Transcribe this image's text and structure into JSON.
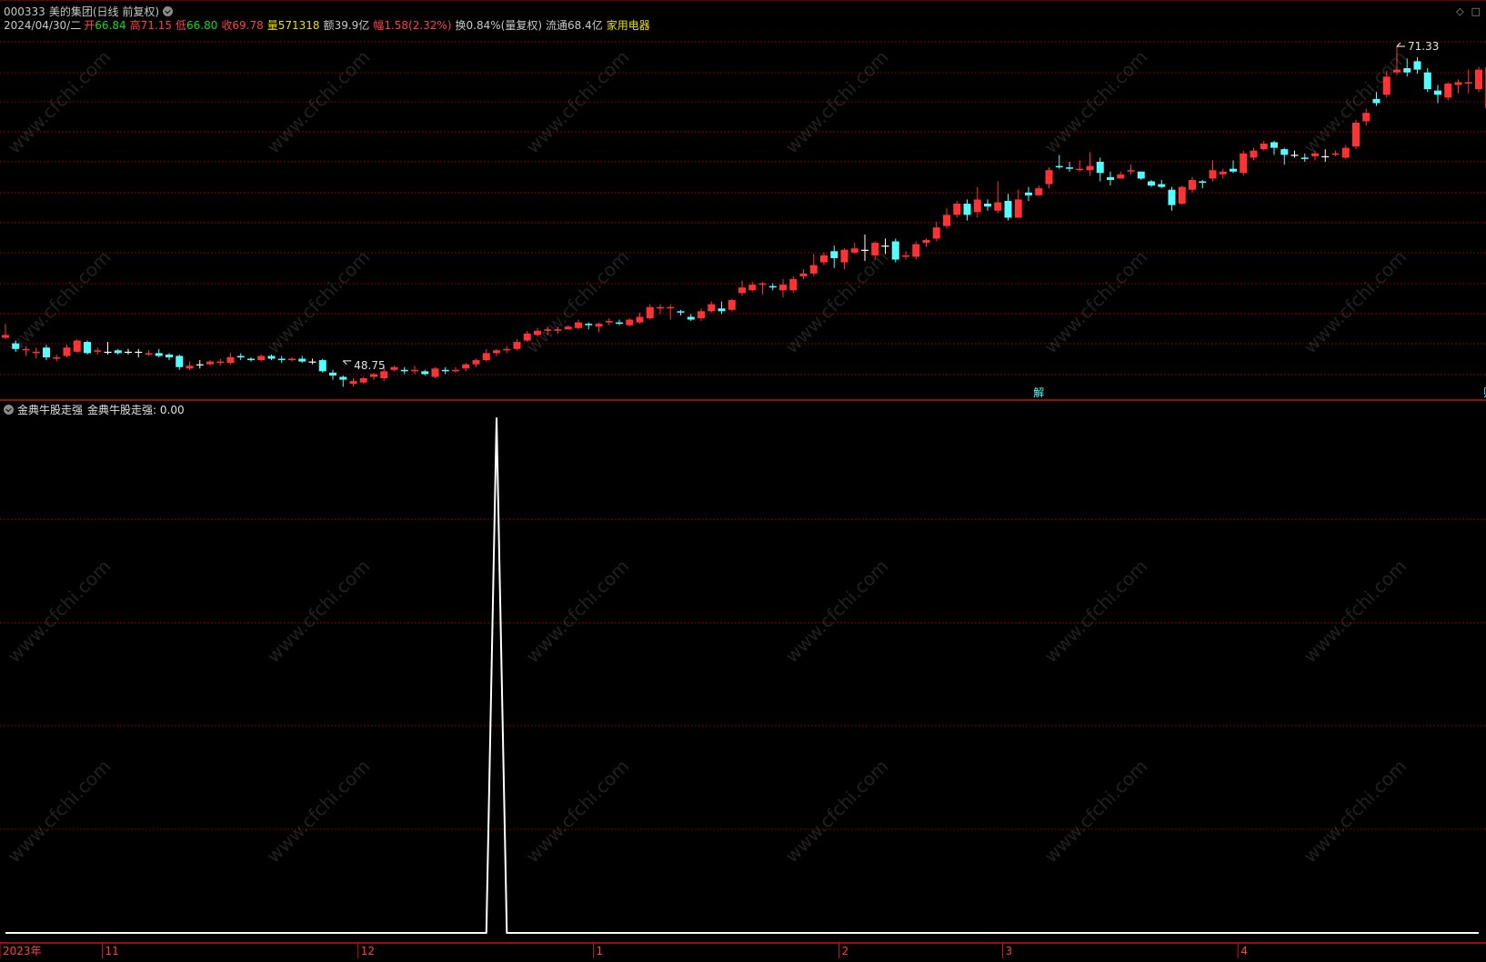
{
  "header": {
    "code": "000333",
    "name": "美的集团",
    "period": "(日线 前复权)",
    "date": "2024/04/30/二",
    "open_label": "开",
    "open": "66.84",
    "high_label": "高",
    "high": "71.15",
    "low_label": "低",
    "low": "66.80",
    "close_label": "收",
    "close": "69.78",
    "vol_label": "量",
    "vol": "571318",
    "amt_label": "额",
    "amt": "39.9亿",
    "chg_label": "幅",
    "chg": "1.58(2.32%)",
    "turn_label": "换",
    "turn": "0.84%(量复权)",
    "float_label": "流通",
    "float": "68.4亿",
    "industry": "家用电器"
  },
  "window_controls": {
    "pin": "◇",
    "close": "□"
  },
  "indicator": {
    "name": "金典牛股走强",
    "line_label": "金典牛股走强:",
    "value": "0.00"
  },
  "watermark": "www.cfchi.com",
  "colors": {
    "up": "#ff3333",
    "down": "#54ffff",
    "doji": "#ffffff",
    "grid": "#8b0000",
    "indicator_line": "#ffffff",
    "axis_text": "#ff4040"
  },
  "chart_data": [
    {
      "type": "candlestick",
      "high_marker": {
        "label": "71.33",
        "value": 71.33
      },
      "low_marker": {
        "label": "48.75",
        "value": 48.75
      },
      "event_markers": [
        {
          "label": "解"
        },
        {
          "label": "财"
        }
      ],
      "candles": [
        [
          50.4,
          50.6,
          51.4,
          50.3
        ],
        [
          50.0,
          49.6,
          50.2,
          49.4
        ],
        [
          49.5,
          49.6,
          49.8,
          49.1
        ],
        [
          49.3,
          49.4,
          49.7,
          48.9
        ],
        [
          49.7,
          49.0,
          49.9,
          48.8
        ],
        [
          48.9,
          49.0,
          49.2,
          48.7
        ],
        [
          49.1,
          49.7,
          49.9,
          49.0
        ],
        [
          49.4,
          50.2,
          50.3,
          49.3
        ],
        [
          50.1,
          49.3,
          50.2,
          49.2
        ],
        [
          49.4,
          49.5,
          49.7,
          49.2
        ],
        [
          49.4,
          49.4,
          50.1,
          49.2
        ],
        [
          49.5,
          49.3,
          49.6,
          49.2
        ],
        [
          49.4,
          49.4,
          49.6,
          49.2
        ],
        [
          49.4,
          49.4,
          49.6,
          49.0
        ],
        [
          49.2,
          49.3,
          49.5,
          49.1
        ],
        [
          49.3,
          49.1,
          49.6,
          49.0
        ],
        [
          49.2,
          49.0,
          49.3,
          48.8
        ],
        [
          49.1,
          48.3,
          49.2,
          48.1
        ],
        [
          48.2,
          48.4,
          48.7,
          48.1
        ],
        [
          48.5,
          48.5,
          48.8,
          48.2
        ],
        [
          48.5,
          48.7,
          48.8,
          48.4
        ],
        [
          48.6,
          48.7,
          48.9,
          48.4
        ],
        [
          48.6,
          49.0,
          49.3,
          48.5
        ],
        [
          49.1,
          49.0,
          49.3,
          48.8
        ],
        [
          48.9,
          48.8,
          49.0,
          48.7
        ],
        [
          48.8,
          49.1,
          49.2,
          48.7
        ],
        [
          49.1,
          48.9,
          49.2,
          48.8
        ],
        [
          48.9,
          48.8,
          49.1,
          48.6
        ],
        [
          48.8,
          48.9,
          49.0,
          48.7
        ],
        [
          48.9,
          48.7,
          49.1,
          48.6
        ],
        [
          48.7,
          48.7,
          48.9,
          48.5
        ],
        [
          48.8,
          48.0,
          48.9,
          47.9
        ],
        [
          47.9,
          47.7,
          48.1,
          47.4
        ],
        [
          47.6,
          47.4,
          47.7,
          46.9
        ],
        [
          47.1,
          47.3,
          47.5,
          46.9
        ],
        [
          47.2,
          47.5,
          47.6,
          47.1
        ],
        [
          47.6,
          47.8,
          47.9,
          47.4
        ],
        [
          47.5,
          48.0,
          48.3,
          47.3
        ],
        [
          48.1,
          48.3,
          48.4,
          48.0
        ],
        [
          48.1,
          48.0,
          48.3,
          47.8
        ],
        [
          48.0,
          48.1,
          48.4,
          47.8
        ],
        [
          48.0,
          47.8,
          48.1,
          47.7
        ],
        [
          47.6,
          48.2,
          48.3,
          47.5
        ],
        [
          48.1,
          48.0,
          48.3,
          47.8
        ],
        [
          48.0,
          48.1,
          48.3,
          47.9
        ],
        [
          48.2,
          48.5,
          48.6,
          48.0
        ],
        [
          48.5,
          48.8,
          48.9,
          48.3
        ],
        [
          48.8,
          49.3,
          49.6,
          48.7
        ],
        [
          49.3,
          49.5,
          49.6,
          49.1
        ],
        [
          49.5,
          49.6,
          49.8,
          49.3
        ],
        [
          49.6,
          50.1,
          50.3,
          49.5
        ],
        [
          50.2,
          50.7,
          50.9,
          50.1
        ],
        [
          50.6,
          50.9,
          51.1,
          50.5
        ],
        [
          50.9,
          51.0,
          51.2,
          50.6
        ],
        [
          50.9,
          51.0,
          51.2,
          50.7
        ],
        [
          51.0,
          51.2,
          51.3,
          51.0
        ],
        [
          51.1,
          51.5,
          51.7,
          51.0
        ],
        [
          51.4,
          51.3,
          51.5,
          51.0
        ],
        [
          51.2,
          51.4,
          51.5,
          50.8
        ],
        [
          51.5,
          51.6,
          51.8,
          51.3
        ],
        [
          51.5,
          51.4,
          51.7,
          51.3
        ],
        [
          51.3,
          51.7,
          51.8,
          51.2
        ],
        [
          51.5,
          51.9,
          52.2,
          51.4
        ],
        [
          51.8,
          52.6,
          52.8,
          51.7
        ],
        [
          52.5,
          52.6,
          52.8,
          52.1
        ],
        [
          52.5,
          52.6,
          52.8,
          51.7
        ],
        [
          52.3,
          52.2,
          52.4,
          52.0
        ],
        [
          51.9,
          51.7,
          52.1,
          51.6
        ],
        [
          51.8,
          52.3,
          52.5,
          51.6
        ],
        [
          52.3,
          52.8,
          53.0,
          52.2
        ],
        [
          52.5,
          52.3,
          53.0,
          52.1
        ],
        [
          52.4,
          53.1,
          53.2,
          52.3
        ],
        [
          53.6,
          54.0,
          54.5,
          53.4
        ],
        [
          53.8,
          54.2,
          54.4,
          53.7
        ],
        [
          54.2,
          54.3,
          54.4,
          53.5
        ],
        [
          54.1,
          54.0,
          54.3,
          53.8
        ],
        [
          53.8,
          54.2,
          54.6,
          53.3
        ],
        [
          53.8,
          54.6,
          54.8,
          53.6
        ],
        [
          54.8,
          55.0,
          55.3,
          54.6
        ],
        [
          55.0,
          55.6,
          56.4,
          54.8
        ],
        [
          55.8,
          56.3,
          56.5,
          55.6
        ],
        [
          56.6,
          56.1,
          57.0,
          55.4
        ],
        [
          55.8,
          56.7,
          56.8,
          55.3
        ],
        [
          56.5,
          56.8,
          57.2,
          56.4
        ],
        [
          56.7,
          56.7,
          57.8,
          55.9
        ],
        [
          56.3,
          57.2,
          57.3,
          56.0
        ],
        [
          57.0,
          57.0,
          57.5,
          56.4
        ],
        [
          57.3,
          56.0,
          57.5,
          55.8
        ],
        [
          56.2,
          56.3,
          56.6,
          56.0
        ],
        [
          56.2,
          57.1,
          57.3,
          56.0
        ],
        [
          57.2,
          57.4,
          57.5,
          56.9
        ],
        [
          57.5,
          58.3,
          58.7,
          57.3
        ],
        [
          58.4,
          59.2,
          59.7,
          58.2
        ],
        [
          59.2,
          60.0,
          60.2,
          59.0
        ],
        [
          60.0,
          59.2,
          60.3,
          58.8
        ],
        [
          59.4,
          60.3,
          61.2,
          59.0
        ],
        [
          60.0,
          59.8,
          60.3,
          59.5
        ],
        [
          59.5,
          60.1,
          61.6,
          59.3
        ],
        [
          60.2,
          59.0,
          60.7,
          58.8
        ],
        [
          59.0,
          60.3,
          61.0,
          59.0
        ],
        [
          60.8,
          60.6,
          61.2,
          60.2
        ],
        [
          60.6,
          61.1,
          61.3,
          60.8
        ],
        [
          61.4,
          62.4,
          62.6,
          61.1
        ],
        [
          62.7,
          62.6,
          63.5,
          62.5
        ],
        [
          62.6,
          62.5,
          63.0,
          62.3
        ],
        [
          62.4,
          62.5,
          63.1,
          62.3
        ],
        [
          62.4,
          62.7,
          63.7,
          62.0
        ],
        [
          63.0,
          62.2,
          63.3,
          61.6
        ],
        [
          61.9,
          61.7,
          62.3,
          61.3
        ],
        [
          61.8,
          62.1,
          62.3,
          61.9
        ],
        [
          62.3,
          62.4,
          62.8,
          62.1
        ],
        [
          62.3,
          61.8,
          62.3,
          61.7
        ],
        [
          61.6,
          61.3,
          61.7,
          61.2
        ],
        [
          61.4,
          61.2,
          61.7,
          61.1
        ],
        [
          61.0,
          59.9,
          61.2,
          59.5
        ],
        [
          60.0,
          61.2,
          61.3,
          59.9
        ],
        [
          61.0,
          61.7,
          61.9,
          60.8
        ],
        [
          61.6,
          61.5,
          61.7,
          61.1
        ],
        [
          61.8,
          62.4,
          63.1,
          61.6
        ],
        [
          62.1,
          62.3,
          62.5,
          61.8
        ],
        [
          62.5,
          62.3,
          63.1,
          62.2
        ],
        [
          62.2,
          63.6,
          63.8,
          62.0
        ],
        [
          63.3,
          63.8,
          64.0,
          63.1
        ],
        [
          63.9,
          64.3,
          64.5,
          63.8
        ],
        [
          64.4,
          64.0,
          64.5,
          63.5
        ],
        [
          63.9,
          63.5,
          64.0,
          62.8
        ],
        [
          63.5,
          63.5,
          63.8,
          63.3
        ],
        [
          63.3,
          63.2,
          63.6,
          63.0
        ],
        [
          63.4,
          63.6,
          63.8,
          63.1
        ],
        [
          63.4,
          63.4,
          63.9,
          63.0
        ],
        [
          63.5,
          63.6,
          63.8,
          63.4
        ],
        [
          63.3,
          64.0,
          64.2,
          63.2
        ],
        [
          64.1,
          65.8,
          66.0,
          63.9
        ],
        [
          65.9,
          66.5,
          66.8,
          65.6
        ],
        [
          67.5,
          67.2,
          68.0,
          67.0
        ],
        [
          67.8,
          69.1,
          69.5,
          67.6
        ],
        [
          69.4,
          69.6,
          71.3,
          69.2
        ],
        [
          69.7,
          69.4,
          70.4,
          69.1
        ],
        [
          70.2,
          69.6,
          70.5,
          69.3
        ],
        [
          69.4,
          68.2,
          69.7,
          68.0
        ],
        [
          68.1,
          67.8,
          68.5,
          67.2
        ],
        [
          67.6,
          68.6,
          68.7,
          67.4
        ],
        [
          68.5,
          68.7,
          68.9,
          67.9
        ],
        [
          68.6,
          68.7,
          69.6,
          67.9
        ],
        [
          68.2,
          69.6,
          69.8,
          68.0
        ],
        [
          66.84,
          69.78,
          71.15,
          66.8
        ]
      ]
    },
    {
      "type": "line",
      "series": [
        {
          "name": "金典牛股走强",
          "values": [
            0,
            0,
            0,
            0,
            0,
            0,
            0,
            0,
            0,
            0,
            0,
            0,
            0,
            0,
            0,
            0,
            0,
            0,
            0,
            0,
            0,
            0,
            0,
            0,
            0,
            0,
            0,
            0,
            0,
            0,
            0,
            0,
            0,
            0,
            0,
            0,
            0,
            0,
            0,
            0,
            0,
            0,
            0,
            0,
            0,
            0,
            0,
            0,
            0,
            0,
            0,
            0,
            0,
            0,
            0,
            0,
            0,
            0,
            0,
            0,
            0,
            0,
            0,
            0,
            0,
            0,
            0,
            0,
            0,
            0,
            0,
            0,
            0,
            0,
            0,
            0,
            0,
            0,
            0,
            0,
            0,
            0,
            0,
            0,
            0,
            0,
            0,
            0,
            0,
            0,
            0,
            0,
            0,
            0,
            0,
            0,
            0,
            0,
            0,
            0,
            0,
            0,
            0,
            0,
            0,
            0,
            0,
            0,
            0,
            0,
            0,
            0,
            0,
            0,
            0,
            0,
            0,
            0,
            0,
            0,
            0,
            0,
            0,
            0,
            0,
            0,
            0,
            0,
            0,
            0,
            0,
            0,
            0,
            0,
            0,
            0,
            0,
            0,
            0,
            0,
            0,
            0,
            0,
            0,
            0
          ]
        }
      ],
      "spike": {
        "index": 48,
        "value": 1
      },
      "ylim": [
        0,
        1
      ]
    }
  ],
  "x_axis": {
    "labels": [
      {
        "text": "2023年",
        "index": 0
      },
      {
        "text": "11",
        "index": 10
      },
      {
        "text": "12",
        "index": 35
      },
      {
        "text": "1",
        "index": 58
      },
      {
        "text": "2",
        "index": 82
      },
      {
        "text": "3",
        "index": 98
      },
      {
        "text": "4",
        "index": 121
      }
    ]
  }
}
